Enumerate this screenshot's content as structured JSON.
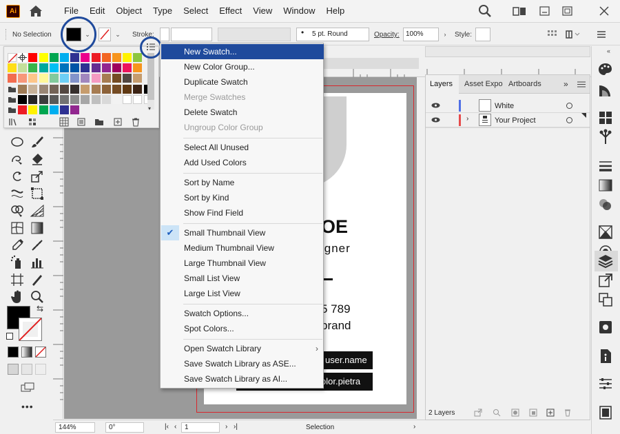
{
  "app": {
    "logo_text": "Ai"
  },
  "menubar": {
    "items": [
      "File",
      "Edit",
      "Object",
      "Type",
      "Select",
      "Effect",
      "View",
      "Window",
      "Help"
    ]
  },
  "controlbar": {
    "selection_label": "No Selection",
    "stroke_label": "Stroke:",
    "brush_label": "5 pt. Round",
    "opacity_label": "Opacity:",
    "opacity_value": "100%",
    "style_label": "Style:"
  },
  "colors": {
    "accent": "#1f4a9c",
    "menu_highlight": "#1f4a9c",
    "artboard_border": "#d8262c",
    "layer_white_color": "#4f6fe6",
    "layer_project_color": "#e64b4b",
    "canvas": "#9a9a9a"
  },
  "swatches": {
    "row1": [
      "#ffffff",
      "#000000",
      "#ff0000",
      "#ffff00",
      "#00a650",
      "#00aeef",
      "#2e3192",
      "#ec008c",
      "#ed1c24",
      "#f26522",
      "#f7941d",
      "#fff200",
      "#8dc63f"
    ],
    "row2": [
      "#ffde17",
      "#c4df9b",
      "#39b54a",
      "#00a99d",
      "#00bff3",
      "#0072bc",
      "#0054a6",
      "#2e3192",
      "#662d91",
      "#92278f",
      "#9e005d",
      "#ed145b",
      "#f7941d"
    ],
    "row3": [
      "#f26c4f",
      "#f7977a",
      "#fdc689",
      "#fff799",
      "#82ca9c",
      "#6dcff6",
      "#8393ca",
      "#a186be",
      "#f49ac1",
      "#a67c52",
      "#754c24",
      "#534741",
      "#c69c6d"
    ],
    "row4": [
      "#9e7b55",
      "#c7b299",
      "#998675",
      "#736357",
      "#534741",
      "#362f2d",
      "#c69c6d",
      "#a67c52",
      "#8c6239",
      "#754c24",
      "#603913",
      "#3c2415",
      "#000000"
    ],
    "row5": [
      "#000000",
      "#262626",
      "#3c3c3c",
      "#595959",
      "#737373",
      "#8c8c8c",
      "#a6a6a6",
      "#bfbfbf",
      "#d9d9d9",
      "#f2f2f2",
      "#ffffff",
      "#ffffff",
      "#ffffff"
    ],
    "row6": [
      "#ed1c24",
      "#fff200",
      "#00a650",
      "#00aeef",
      "#2e3192",
      "#92278f"
    ]
  },
  "flyout": {
    "items": [
      {
        "label": "New Swatch...",
        "state": "highlighted"
      },
      {
        "label": "New Color Group...",
        "state": "normal"
      },
      {
        "label": "Duplicate Swatch",
        "state": "normal"
      },
      {
        "label": "Merge Swatches",
        "state": "disabled"
      },
      {
        "label": "Delete Swatch",
        "state": "normal"
      },
      {
        "label": "Ungroup Color Group",
        "state": "disabled"
      },
      {
        "label": "Select All Unused",
        "state": "normal"
      },
      {
        "label": "Add Used Colors",
        "state": "normal"
      },
      {
        "label": "Sort by Name",
        "state": "normal"
      },
      {
        "label": "Sort by Kind",
        "state": "normal"
      },
      {
        "label": "Show Find Field",
        "state": "normal"
      },
      {
        "label": "Small Thumbnail View",
        "state": "checked"
      },
      {
        "label": "Medium Thumbnail View",
        "state": "normal"
      },
      {
        "label": "Large Thumbnail View",
        "state": "normal"
      },
      {
        "label": "Small List View",
        "state": "normal"
      },
      {
        "label": "Large List View",
        "state": "normal"
      },
      {
        "label": "Swatch Options...",
        "state": "normal"
      },
      {
        "label": "Spot Colors...",
        "state": "normal"
      },
      {
        "label": "Open Swatch Library",
        "state": "submenu"
      },
      {
        "label": "Save Swatch Library as ASE...",
        "state": "normal"
      },
      {
        "label": "Save Swatch Library as AI...",
        "state": "normal"
      }
    ]
  },
  "artboard": {
    "name_partial": "OE",
    "title_partial": "igner",
    "phone_partial": "5 789",
    "brand_partial": "brand",
    "pill1": "user.name",
    "pill2": "olor.pietra"
  },
  "layers": {
    "tabs": [
      "Layers",
      "Asset Expor",
      "Artboards"
    ],
    "rows": [
      {
        "name": "White"
      },
      {
        "name": "Your Project"
      }
    ],
    "count": "2 Layers"
  },
  "statusbar": {
    "zoom": "144%",
    "rotation": "0°",
    "artboard_num": "1",
    "mode": "Selection"
  }
}
